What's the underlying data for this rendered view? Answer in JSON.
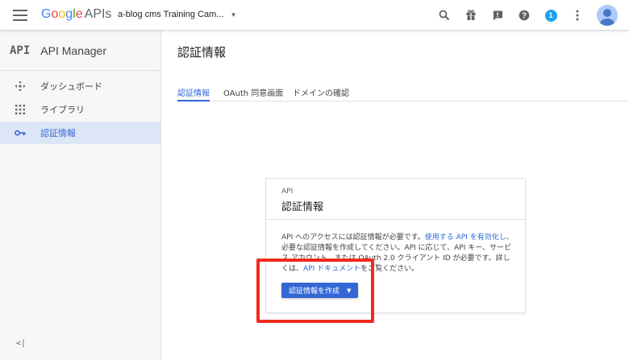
{
  "header": {
    "logo": {
      "google": [
        "G",
        "o",
        "o",
        "g",
        "l",
        "e"
      ],
      "apis": "APIs"
    },
    "project": "a-blog cms Training Cam...",
    "notification_count": "1"
  },
  "sidebar": {
    "badge": "API",
    "title": "API Manager",
    "items": [
      {
        "label": "ダッシュボード",
        "icon": "dashboard-icon"
      },
      {
        "label": "ライブラリ",
        "icon": "library-icon"
      },
      {
        "label": "認証情報",
        "icon": "key-icon",
        "active": true
      }
    ],
    "collapse": "<|"
  },
  "main": {
    "title": "認証情報",
    "tabs": [
      {
        "label": "認証情報",
        "active": true
      },
      {
        "label": "OAuth 同意画面"
      },
      {
        "label": "ドメインの確認"
      }
    ],
    "card": {
      "subtitle": "API",
      "title": "認証情報",
      "body_prefix": "API へのアクセスには認証情報が必要です。",
      "link1": "使用する API を有効化し",
      "body_middle": "、必要な認証情報を作成してください。API に応じて、API キー、サービス アカウント、または OAuth 2.0 クライアント ID が必要です。詳しくは、",
      "link2": "API ドキュメント",
      "body_suffix": "をご覧ください。",
      "button": "認証情報を作成"
    }
  },
  "colors": {
    "accent": "#3367d6",
    "highlight": "#f02b1d",
    "active_bg": "#dde6f7"
  }
}
